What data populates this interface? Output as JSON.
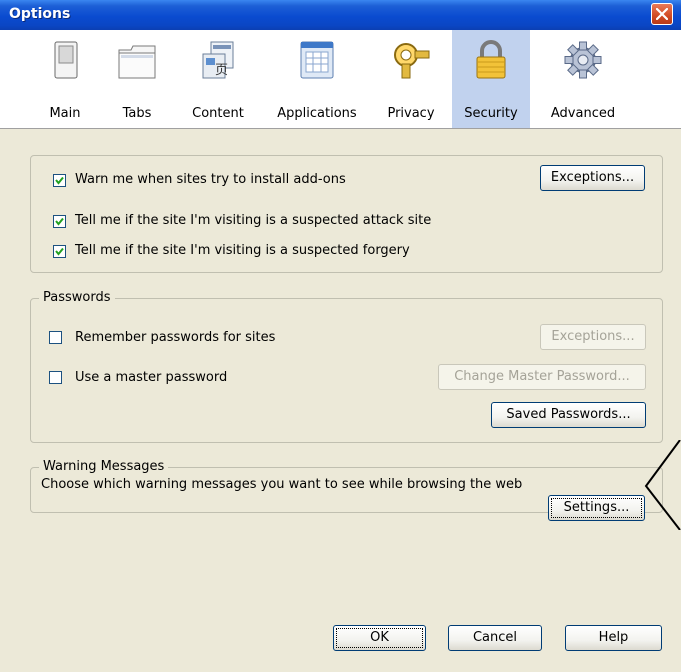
{
  "window": {
    "title": "Options"
  },
  "toolbar": {
    "panes": [
      {
        "label": "Main",
        "icon": "switch-icon"
      },
      {
        "label": "Tabs",
        "icon": "tabs-icon"
      },
      {
        "label": "Content",
        "icon": "content-icon"
      },
      {
        "label": "Applications",
        "icon": "applications-icon"
      },
      {
        "label": "Privacy",
        "icon": "mask-icon"
      },
      {
        "label": "Security",
        "icon": "padlock-icon",
        "selected": true
      },
      {
        "label": "Advanced",
        "icon": "gear-icon"
      }
    ]
  },
  "addons": {
    "warn_label": "Warn me when sites try to install add-ons",
    "warn_checked": true,
    "exceptions_label": "Exceptions...",
    "attack_label": "Tell me if the site I'm visiting is a suspected attack site",
    "attack_checked": true,
    "forgery_label": "Tell me if the site I'm visiting is a suspected forgery",
    "forgery_checked": true
  },
  "passwords": {
    "legend": "Passwords",
    "remember_label": "Remember passwords for sites",
    "remember_checked": false,
    "exceptions_label": "Exceptions...",
    "master_label": "Use a master password",
    "master_checked": false,
    "change_master_label": "Change Master Password...",
    "saved_label": "Saved Passwords..."
  },
  "warnings": {
    "legend": "Warning Messages",
    "description": "Choose which warning messages you want to see while browsing the web",
    "settings_label": "Settings..."
  },
  "footer": {
    "ok_label": "OK",
    "cancel_label": "Cancel",
    "help_label": "Help"
  },
  "colors": {
    "dialog_bg": "#ece9d8",
    "selected_pane": "#c1d2ee",
    "checkmark": "#21a121"
  }
}
